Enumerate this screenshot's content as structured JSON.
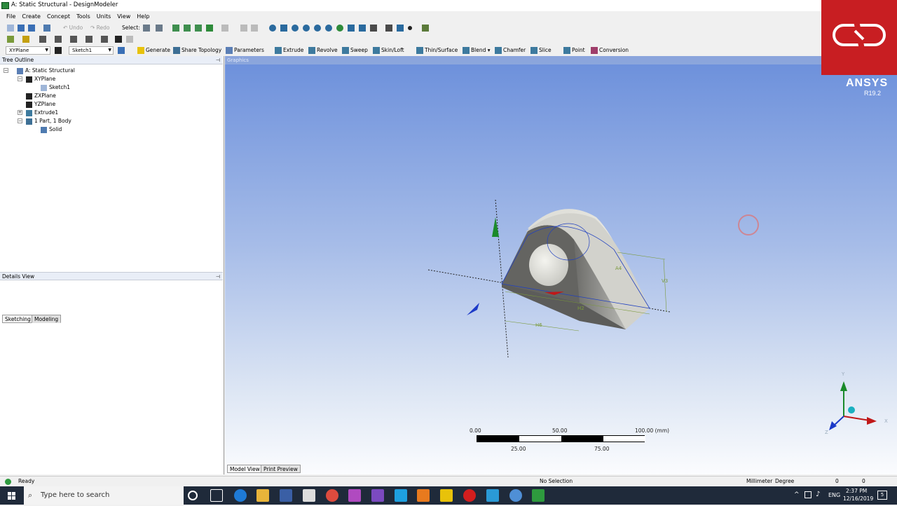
{
  "window": {
    "title": "A: Static Structural - DesignModeler"
  },
  "menu": {
    "items": [
      "File",
      "Create",
      "Concept",
      "Tools",
      "Units",
      "View",
      "Help"
    ]
  },
  "toolbar1": {
    "undo_label": "Undo",
    "redo_label": "Redo",
    "select_label": "Select:"
  },
  "toolbar3": {
    "plane_value": "XYPlane",
    "sketch_value": "Sketch1",
    "generate": "Generate",
    "share_topology": "Share Topology",
    "parameters": "Parameters",
    "extrude": "Extrude",
    "revolve": "Revolve",
    "sweep": "Sweep",
    "skin_loft": "Skin/Loft",
    "thin_surface": "Thin/Surface",
    "blend": "Blend",
    "chamfer": "Chamfer",
    "slice": "Slice",
    "point": "Point",
    "conversion": "Conversion"
  },
  "tree_outline": {
    "header": "Tree Outline",
    "items": [
      "A: Static Structural",
      "XYPlane",
      "Sketch1",
      "ZXPlane",
      "YZPlane",
      "Extrude1",
      "1 Part, 1 Body",
      "Solid"
    ]
  },
  "tabs": {
    "sketching": "Sketching",
    "modeling": "Modeling"
  },
  "details_view": {
    "header": "Details View"
  },
  "graphics": {
    "header": "Graphics",
    "brand": "ANSYS",
    "version": "R19.2",
    "dims": [
      "H6",
      "V3",
      "A4",
      "H2"
    ],
    "axis_labels": {
      "y": "Y",
      "x": "X",
      "z": "Z"
    }
  },
  "scale": {
    "top_labels": [
      "0.00",
      "50.00",
      "100.00 (mm)"
    ],
    "bottom_labels": [
      "25.00",
      "75.00"
    ]
  },
  "bottom_tabs": {
    "model_view": "Model View",
    "print_preview": "Print Preview"
  },
  "status": {
    "ready": "Ready",
    "selection": "No Selection",
    "units_length": "Millimeter",
    "units_angle": "Degree",
    "val1": "0",
    "val2": "0"
  },
  "taskbar": {
    "search_placeholder": "Type here to search",
    "lang": "ENG",
    "time": "2:37 PM",
    "date": "12/16/2019",
    "notifications": "5"
  },
  "colors": {
    "logo_red": "#c81e22",
    "graphics_top": "#6b8fdb",
    "taskbar": "#1f2a3a"
  }
}
